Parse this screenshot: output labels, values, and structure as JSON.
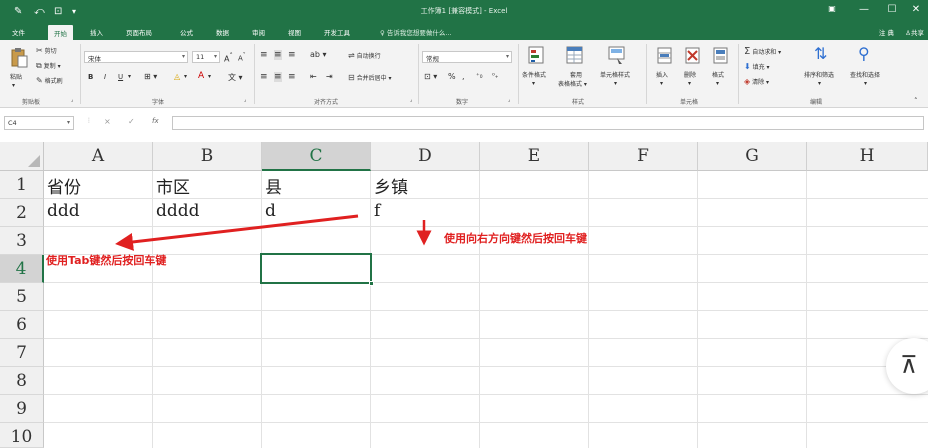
{
  "title_bar": {
    "title": "工作簿1 [兼容模式] - Excel",
    "quick_access": [
      "save-icon",
      "undo-icon",
      "redo-icon"
    ]
  },
  "tabs": {
    "items": [
      "文件",
      "开始",
      "插入",
      "页面布局",
      "公式",
      "数据",
      "审阅",
      "视图",
      "开发工具"
    ],
    "active": "开始",
    "tell_me": "告诉我您想要做什么...",
    "user": "注 典",
    "share": "共享"
  },
  "ribbon": {
    "clipboard": {
      "paste": "粘贴",
      "cut": "剪切",
      "copy": "复制",
      "format_painter": "格式刷",
      "label": "剪贴板"
    },
    "font": {
      "name": "宋体",
      "size": "11",
      "grow": "A",
      "shrink": "A",
      "bold": "B",
      "italic": "I",
      "underline": "U",
      "label": "字体"
    },
    "alignment": {
      "wrap": "自动换行",
      "merge": "合并后居中",
      "label": "对齐方式"
    },
    "number": {
      "format": "常规",
      "percent": "%",
      "comma": ",",
      "label": "数字"
    },
    "styles": {
      "conditional": "条件格式",
      "table_line1": "套用",
      "table_line2": "表格格式",
      "cell_styles": "单元格样式",
      "label": "样式"
    },
    "cells": {
      "insert": "插入",
      "delete": "删除",
      "format": "格式",
      "label": "单元格"
    },
    "editing": {
      "autosum": "自动求和",
      "fill": "填充",
      "clear": "清除",
      "sort": "排序和筛选",
      "find": "查找和选择",
      "label": "编辑"
    }
  },
  "formula_bar": {
    "name_box": "C4",
    "cancel": "×",
    "enter": "✓",
    "fx": "fx",
    "content": ""
  },
  "sheet": {
    "columns": [
      "A",
      "B",
      "C",
      "D",
      "E",
      "F",
      "G",
      "H"
    ],
    "rows": [
      "1",
      "2",
      "3",
      "4",
      "5",
      "6",
      "7",
      "8",
      "9",
      "10"
    ],
    "selected_column": "C",
    "selected_row": "4",
    "cells": {
      "A1": "省份",
      "B1": "市区",
      "C1": "县",
      "D1": "乡镇",
      "A2": "ddd",
      "B2": "dddd",
      "C2": "d",
      "D2": "f"
    }
  },
  "annotations": {
    "right_then_enter": "使用向右方向键然后按回车键",
    "tab_then_enter": "使用Tab键然后按回车键",
    "color": "#e02020"
  },
  "scroll_top": {
    "glyph": "⊼"
  }
}
